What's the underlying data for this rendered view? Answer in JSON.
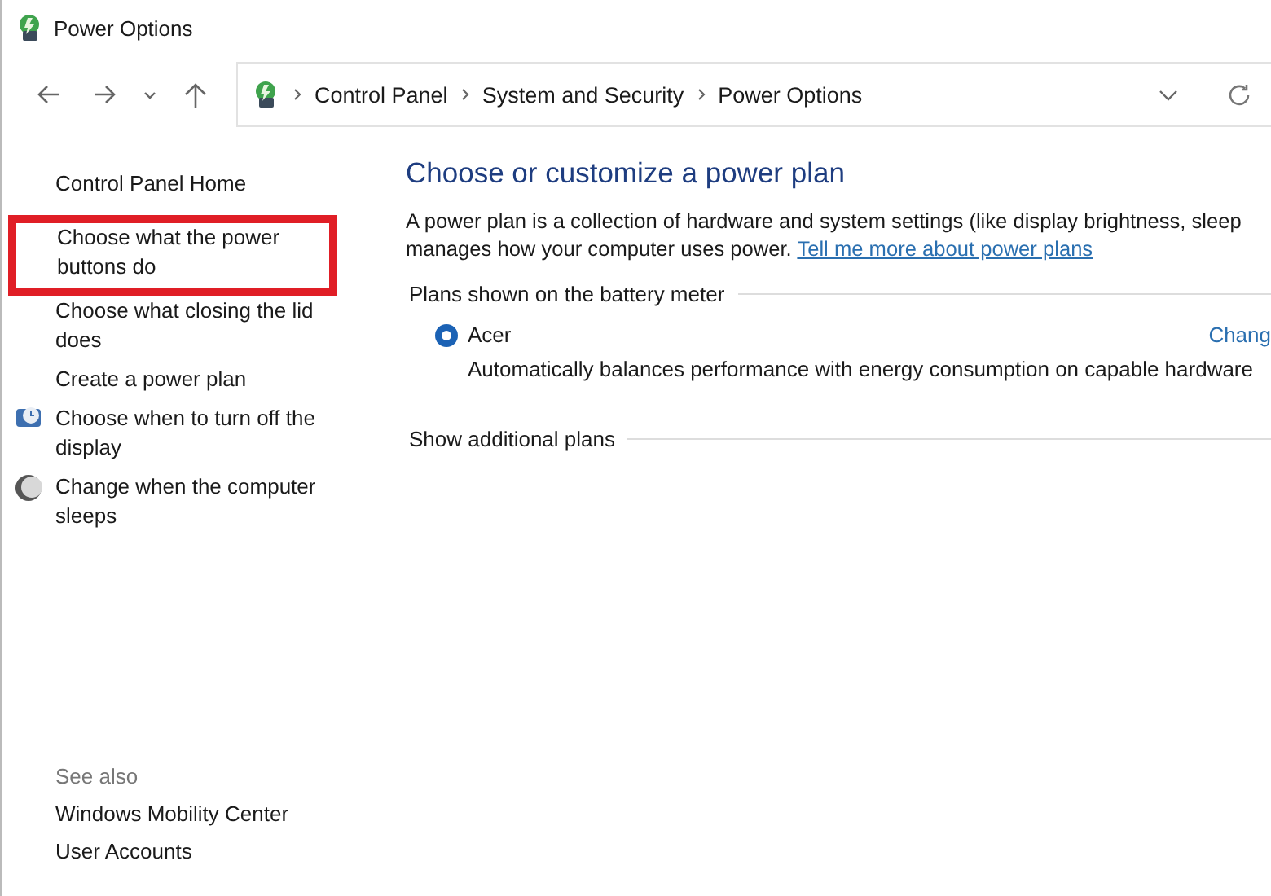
{
  "window": {
    "title": "Power Options"
  },
  "address_bar": {
    "breadcrumbs": [
      "Control Panel",
      "System and Security",
      "Power Options"
    ]
  },
  "sidebar": {
    "items": [
      {
        "label": "Control Panel Home",
        "kind": "text",
        "highlighted": false
      },
      {
        "label": "Choose what the power buttons do",
        "kind": "text",
        "highlighted": true
      },
      {
        "label": "Choose what closing the lid does",
        "kind": "text",
        "highlighted": false
      },
      {
        "label": "Create a power plan",
        "kind": "text",
        "highlighted": false
      },
      {
        "label": "Choose when to turn off the display",
        "kind": "display",
        "highlighted": false
      },
      {
        "label": "Change when the computer sleeps",
        "kind": "sleep",
        "highlighted": false
      }
    ],
    "see_also": {
      "heading": "See also",
      "links": [
        "Windows Mobility Center",
        "User Accounts"
      ]
    }
  },
  "main": {
    "heading": "Choose or customize a power plan",
    "description": "A power plan is a collection of hardware and system settings (like display brightness, sleep",
    "description_2": "manages how your computer uses power.",
    "link": "Tell me more about power plans",
    "plans_group": {
      "label": "Plans shown on the battery meter",
      "plans": [
        {
          "name": "Acer",
          "selected": true,
          "action": "Chang",
          "description": "Automatically balances performance with energy consumption on capable hardware"
        }
      ]
    },
    "additional": {
      "label": "Show additional plans"
    }
  }
}
